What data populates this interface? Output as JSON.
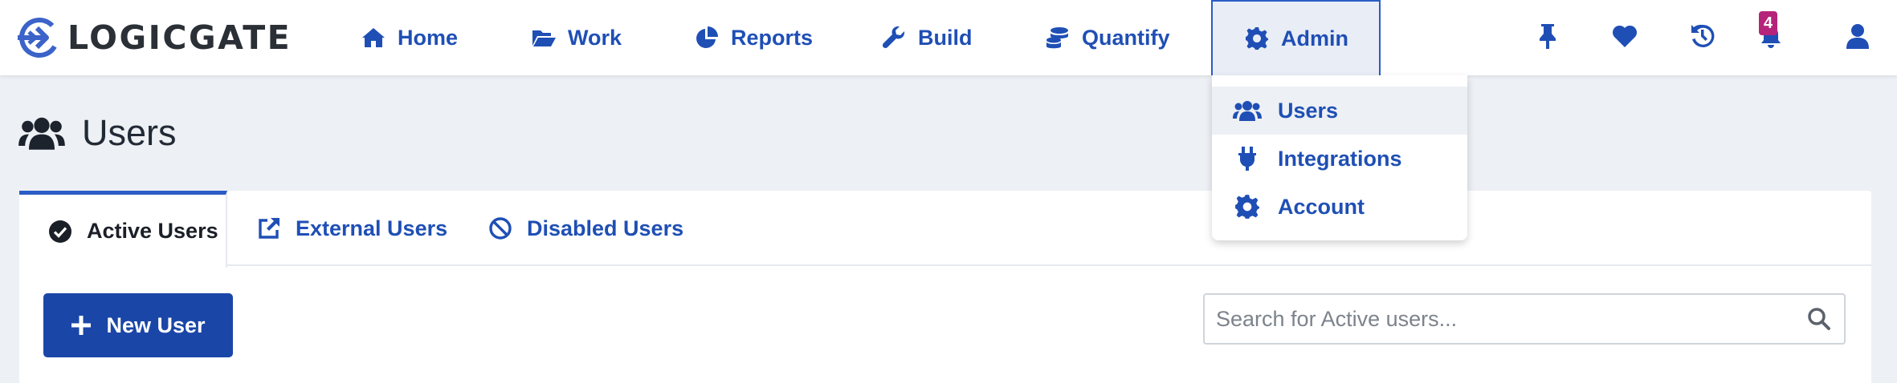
{
  "app": {
    "logo_text": "LOGICGATE",
    "accent_color": "#1f4fb5"
  },
  "nav": {
    "items": [
      {
        "label": "Home",
        "icon": "home-icon"
      },
      {
        "label": "Work",
        "icon": "folder-open-icon"
      },
      {
        "label": "Reports",
        "icon": "pie-chart-icon"
      },
      {
        "label": "Build",
        "icon": "wrench-icon"
      },
      {
        "label": "Quantify",
        "icon": "coins-icon"
      },
      {
        "label": "Admin",
        "icon": "gear-icon",
        "active": true
      }
    ],
    "right_icons": [
      "pin-icon",
      "heart-icon",
      "history-icon",
      "bell-icon",
      "user-icon"
    ],
    "notification_count": "4",
    "badge_color": "#b5247a"
  },
  "admin_menu": {
    "items": [
      {
        "label": "Users",
        "icon": "users-icon",
        "highlighted": true
      },
      {
        "label": "Integrations",
        "icon": "plug-icon"
      },
      {
        "label": "Account",
        "icon": "gear-icon"
      }
    ]
  },
  "page": {
    "title": "Users",
    "title_icon": "users-icon"
  },
  "tabs": [
    {
      "label": "Active Users",
      "icon": "check-circle-icon",
      "active": true
    },
    {
      "label": "External Users",
      "icon": "external-link-icon"
    },
    {
      "label": "Disabled Users",
      "icon": "ban-icon"
    }
  ],
  "toolbar": {
    "new_user_label": "New User"
  },
  "search": {
    "placeholder": "Search for Active users...",
    "value": ""
  }
}
